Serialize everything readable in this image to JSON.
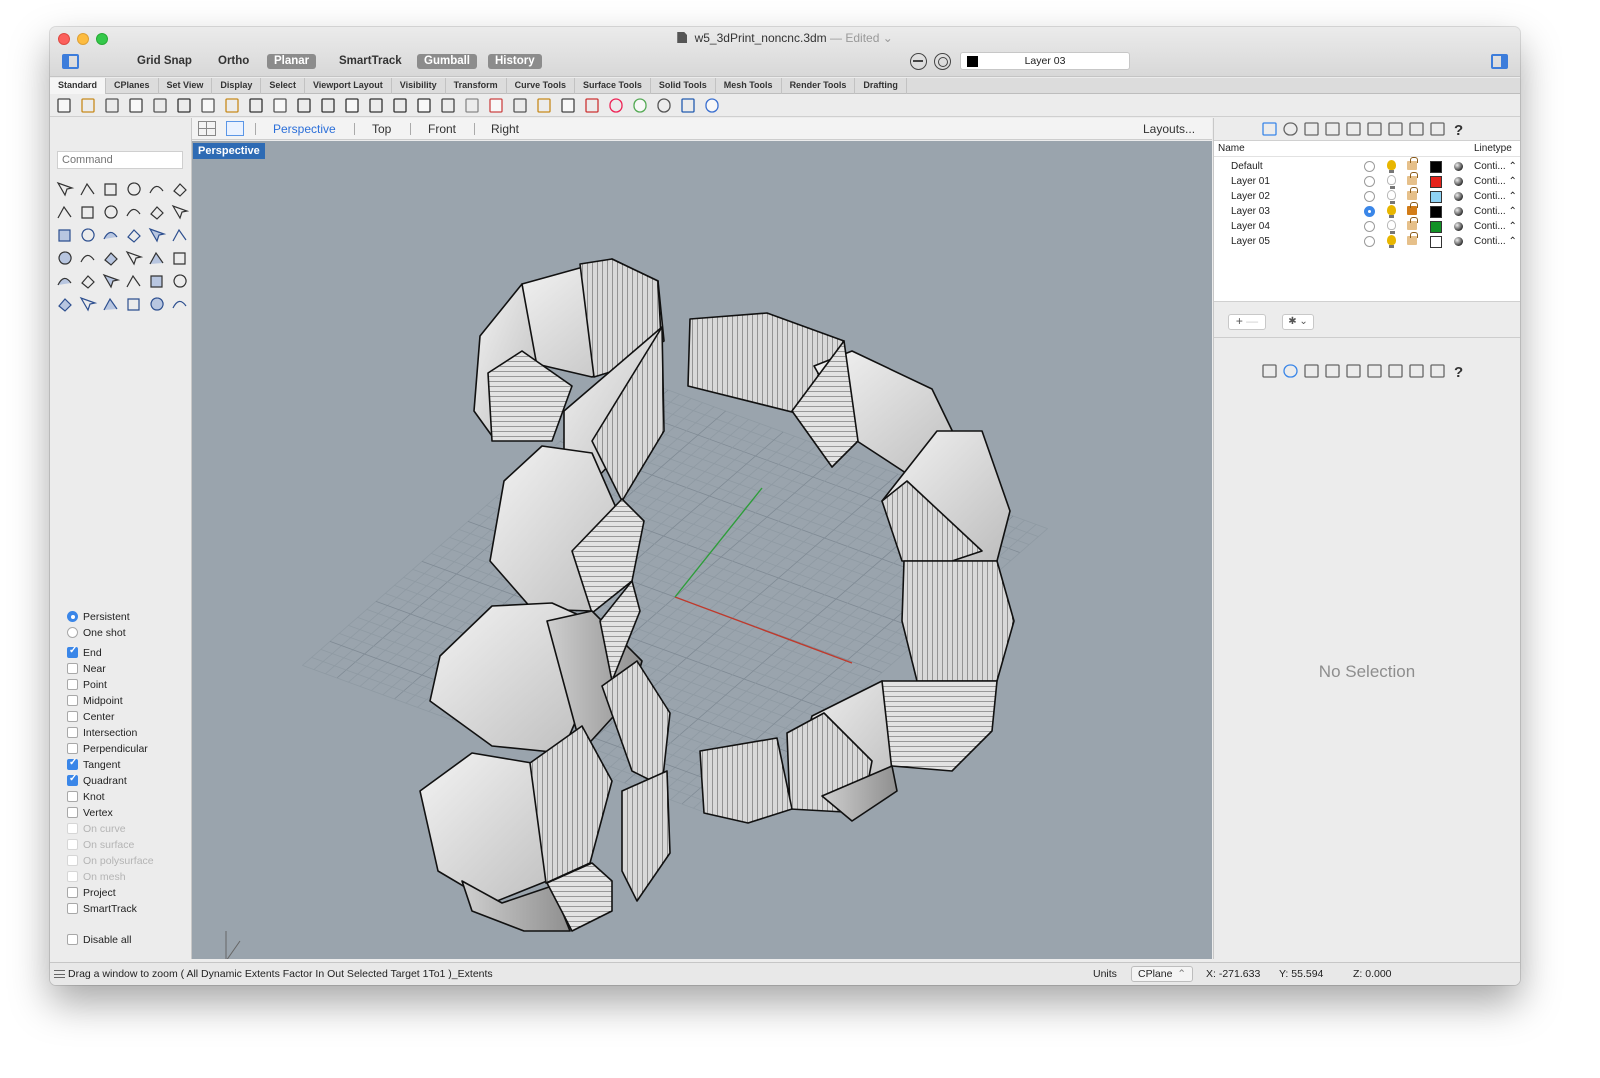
{
  "window": {
    "title": "w5_3dPrint_noncnc.3dm",
    "edited": "— Edited ⌄"
  },
  "modes": [
    {
      "label": "Grid Snap",
      "on": false
    },
    {
      "label": "Ortho",
      "on": false
    },
    {
      "label": "Planar",
      "on": true
    },
    {
      "label": "SmartTrack",
      "on": false
    },
    {
      "label": "Gumball",
      "on": true
    },
    {
      "label": "History",
      "on": true
    }
  ],
  "current_layer": "Layer 03",
  "tabs": [
    "Standard",
    "CPlanes",
    "Set View",
    "Display",
    "Select",
    "Viewport Layout",
    "Visibility",
    "Transform",
    "Curve Tools",
    "Surface Tools",
    "Solid Tools",
    "Mesh Tools",
    "Render Tools",
    "Drafting"
  ],
  "toolbar_icons": [
    "new-file-icon",
    "open-icon",
    "save-icon",
    "print-icon",
    "import-icon",
    "cut-icon",
    "copy-icon",
    "paste-icon",
    "undo-icon",
    "pan-icon",
    "rotate-view-icon",
    "zoom-icon",
    "zoom-window-icon",
    "zoom-extents-icon",
    "zoom-selected-icon",
    "undo-view-icon",
    "grid-icon",
    "cplane-icon",
    "hide-icon",
    "show-icon",
    "light-icon",
    "lock-icon",
    "select-icon",
    "color-wheel-icon",
    "render-icon",
    "sphere-icon",
    "material-icon",
    "help-icon"
  ],
  "command": {
    "placeholder": "Command"
  },
  "viewport_tabs": [
    "Perspective",
    "Top",
    "Front",
    "Right"
  ],
  "active_viewport": "Perspective",
  "layouts_label": "Layouts...",
  "viewport_label": "Perspective",
  "osnaps": {
    "persistent": "Persistent",
    "one_shot": "One shot",
    "items": [
      {
        "label": "End",
        "checked": true,
        "enabled": true
      },
      {
        "label": "Near",
        "checked": false,
        "enabled": true
      },
      {
        "label": "Point",
        "checked": false,
        "enabled": true
      },
      {
        "label": "Midpoint",
        "checked": false,
        "enabled": true
      },
      {
        "label": "Center",
        "checked": false,
        "enabled": true
      },
      {
        "label": "Intersection",
        "checked": false,
        "enabled": true
      },
      {
        "label": "Perpendicular",
        "checked": false,
        "enabled": true
      },
      {
        "label": "Tangent",
        "checked": true,
        "enabled": true
      },
      {
        "label": "Quadrant",
        "checked": true,
        "enabled": true
      },
      {
        "label": "Knot",
        "checked": false,
        "enabled": true
      },
      {
        "label": "Vertex",
        "checked": false,
        "enabled": true
      },
      {
        "label": "On curve",
        "checked": false,
        "enabled": false
      },
      {
        "label": "On surface",
        "checked": false,
        "enabled": false
      },
      {
        "label": "On polysurface",
        "checked": false,
        "enabled": false
      },
      {
        "label": "On mesh",
        "checked": false,
        "enabled": false
      },
      {
        "label": "Project",
        "checked": false,
        "enabled": true
      },
      {
        "label": "SmartTrack",
        "checked": false,
        "enabled": true
      }
    ],
    "disable_all": "Disable all"
  },
  "layers_panel": {
    "col_name": "Name",
    "col_linetype": "Linetype",
    "rows": [
      {
        "name": "Default",
        "current": false,
        "on": true,
        "locked": false,
        "color": "#000000",
        "linetype": "Conti... ⌃"
      },
      {
        "name": "Layer 01",
        "current": false,
        "on": false,
        "locked": false,
        "color": "#e5231b",
        "linetype": "Conti... ⌃"
      },
      {
        "name": "Layer 02",
        "current": false,
        "on": false,
        "locked": false,
        "color": "#8fd3f5",
        "linetype": "Conti... ⌃"
      },
      {
        "name": "Layer 03",
        "current": true,
        "on": true,
        "locked": true,
        "color": "#000000",
        "linetype": "Conti... ⌃"
      },
      {
        "name": "Layer 04",
        "current": false,
        "on": false,
        "locked": false,
        "color": "#119125",
        "linetype": "Conti... ⌃"
      },
      {
        "name": "Layer 05",
        "current": false,
        "on": true,
        "locked": false,
        "color": "#ffffff",
        "linetype": "Conti... ⌃"
      }
    ],
    "add": "+",
    "remove": "—",
    "gear": "✱ ⌄"
  },
  "properties": {
    "no_selection": "No Selection"
  },
  "status": {
    "prompt": "Drag a window to zoom ( All Dynamic Extents Factor In Out Selected Target 1To1 )_Extents",
    "units": "Units",
    "cplane": "CPlane",
    "x": "X: -271.633",
    "y": "Y: 55.594",
    "z": "Z: 0.000"
  },
  "colors": {
    "accent": "#2b6fd9",
    "viewport_bg": "#9aa4ad",
    "viewport_label_bg": "#2e6bb4"
  }
}
